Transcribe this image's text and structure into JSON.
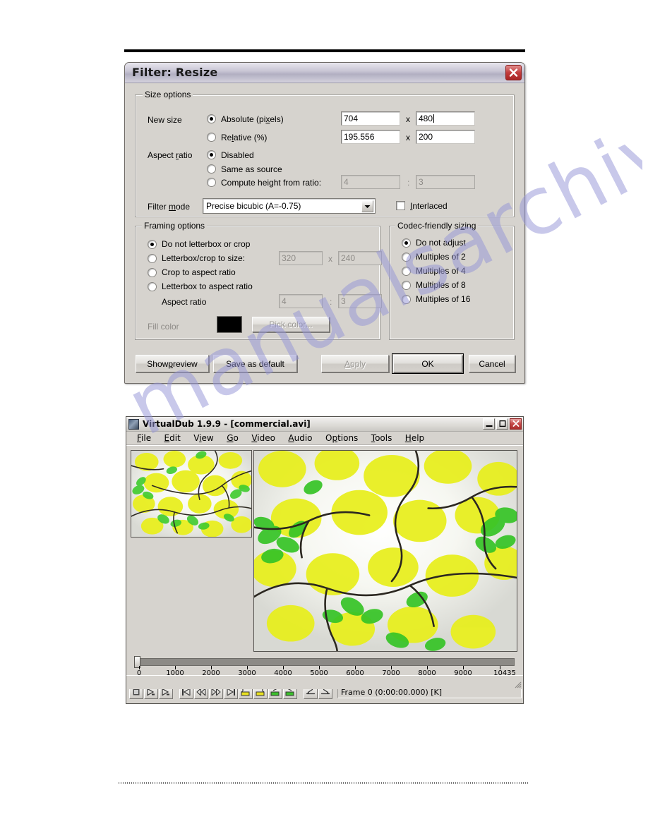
{
  "watermark": {
    "text": "manualsarchive.com"
  },
  "resize_dialog": {
    "title": "Filter: Resize",
    "close_icon": "close-icon",
    "size_options": {
      "legend": "Size options",
      "new_size_label": "New size",
      "absolute_label": "Absolute (pixels)",
      "absolute_selected": true,
      "absolute_width": "704",
      "absolute_height": "480",
      "relative_label": "Relative (%)",
      "relative_selected": false,
      "relative_width": "195.556",
      "relative_height": "200",
      "x_separator": "x",
      "aspect_ratio_label": "Aspect ratio",
      "aspect_disabled_label": "Disabled",
      "aspect_disabled_selected": true,
      "aspect_same_label": "Same as source",
      "aspect_same_selected": false,
      "aspect_compute_label": "Compute height from ratio:",
      "aspect_compute_selected": false,
      "ratio_w": "4",
      "ratio_h": "3",
      "ratio_separator": ":",
      "filter_mode_label": "Filter mode",
      "filter_mode_value": "Precise bicubic (A=-0.75)",
      "dropdown_icon": "chevron-down-icon",
      "interlaced_label": "Interlaced",
      "interlaced_checked": false
    },
    "framing_options": {
      "legend": "Framing options",
      "items": [
        {
          "label": "Do not letterbox or crop",
          "selected": true
        },
        {
          "label": "Letterbox/crop to size:",
          "selected": false
        },
        {
          "label": "Crop to aspect ratio",
          "selected": false
        },
        {
          "label": "Letterbox to aspect ratio",
          "selected": false
        }
      ],
      "crop_width": "320",
      "crop_height": "240",
      "x_separator": "x",
      "aspect_ratio_label": "Aspect ratio",
      "aspect_w": "4",
      "aspect_h": "3",
      "ratio_separator": ":",
      "fill_color_label": "Fill color",
      "fill_color_value": "#000000",
      "pick_color_label": "Pick color..."
    },
    "codec_options": {
      "legend": "Codec-friendly sizing",
      "items": [
        {
          "label": "Do not adjust",
          "selected": true
        },
        {
          "label": "Multiples of 2",
          "selected": false
        },
        {
          "label": "Multiples of 4",
          "selected": false
        },
        {
          "label": "Multiples of 8",
          "selected": false
        },
        {
          "label": "Multiples of 16",
          "selected": false
        }
      ]
    },
    "buttons": {
      "show_preview": "Show preview",
      "save_as_default": "Save as default",
      "apply": "Apply",
      "apply_enabled": false,
      "ok": "OK",
      "cancel": "Cancel"
    }
  },
  "virtualdub": {
    "title": "VirtualDub 1.9.9 - [commercial.avi]",
    "app_icon": "virtualdub-icon",
    "window_buttons": {
      "minimize": "minimize-icon",
      "maximize": "maximize-icon",
      "close": "close-icon"
    },
    "menu": [
      "File",
      "Edit",
      "View",
      "Go",
      "Video",
      "Audio",
      "Options",
      "Tools",
      "Help"
    ],
    "timeline": {
      "position": 0,
      "min": 0,
      "max": 10435,
      "tick_labels": [
        "0",
        "1000",
        "2000",
        "3000",
        "4000",
        "5000",
        "6000",
        "7000",
        "8000",
        "9000",
        "10435"
      ]
    },
    "status_text": "Frame 0 (0:00:00.000) [K]",
    "toolbar_buttons": [
      "stop-icon",
      "play-icon",
      "play-input-icon",
      "start-icon",
      "prev-keyframe-icon",
      "next-keyframe-icon",
      "end-icon",
      "prev-drop-icon",
      "next-drop-icon",
      "prev-range-icon",
      "next-range-icon",
      "mark-in-icon",
      "mark-out-icon"
    ]
  }
}
